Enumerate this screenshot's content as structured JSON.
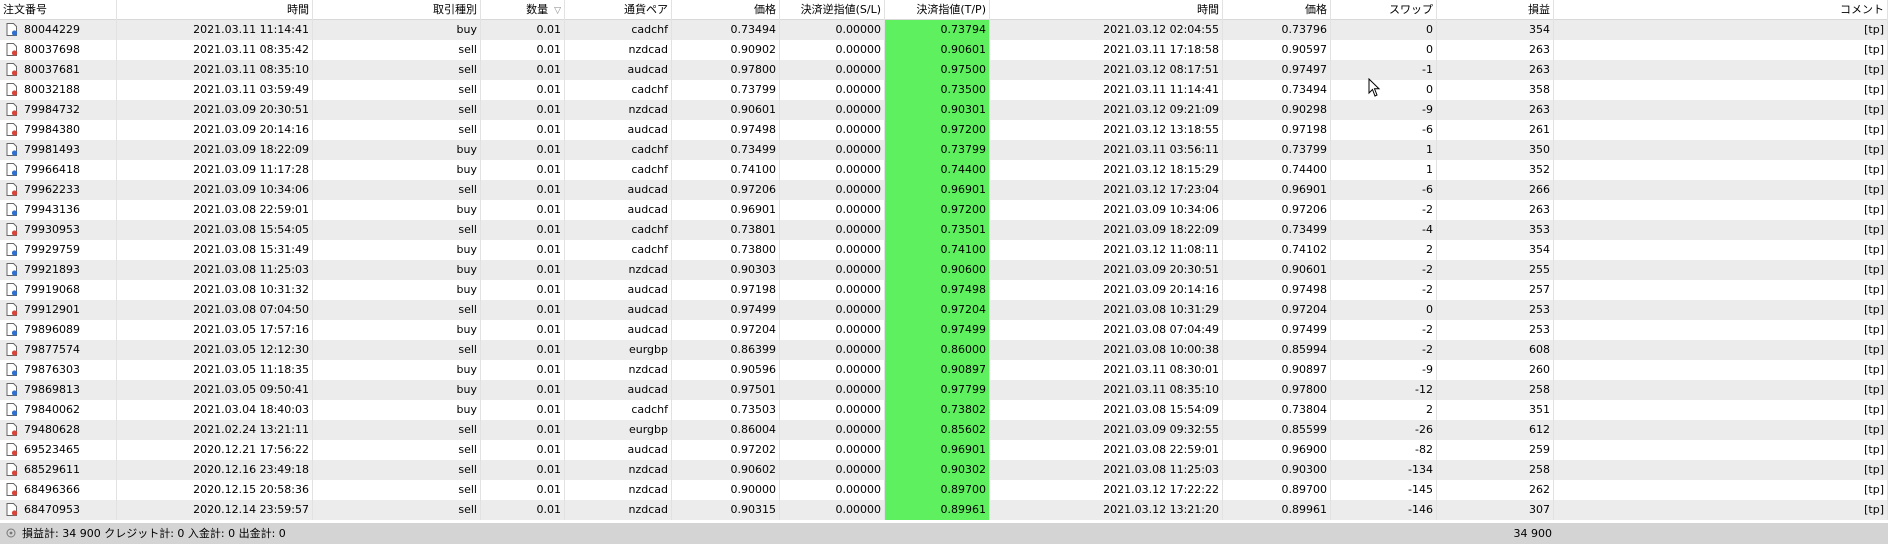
{
  "headers": [
    "注文番号",
    "時間",
    "取引種別",
    "数量",
    "通貨ペア",
    "価格",
    "決済逆指値(S/L)",
    "決済指値(T/P)",
    "時間",
    "価格",
    "スワップ",
    "損益",
    "コメント"
  ],
  "rows": [
    [
      "80044229",
      "2021.03.11 11:14:41",
      "buy",
      "0.01",
      "cadchf",
      "0.73494",
      "0.00000",
      "0.73794",
      "2021.03.12 02:04:55",
      "0.73796",
      "0",
      "354",
      "[tp]"
    ],
    [
      "80037698",
      "2021.03.11 08:35:42",
      "sell",
      "0.01",
      "nzdcad",
      "0.90902",
      "0.00000",
      "0.90601",
      "2021.03.11 17:18:58",
      "0.90597",
      "0",
      "263",
      "[tp]"
    ],
    [
      "80037681",
      "2021.03.11 08:35:10",
      "sell",
      "0.01",
      "audcad",
      "0.97800",
      "0.00000",
      "0.97500",
      "2021.03.12 08:17:51",
      "0.97497",
      "-1",
      "263",
      "[tp]"
    ],
    [
      "80032188",
      "2021.03.11 03:59:49",
      "sell",
      "0.01",
      "cadchf",
      "0.73799",
      "0.00000",
      "0.73500",
      "2021.03.11 11:14:41",
      "0.73494",
      "0",
      "358",
      "[tp]"
    ],
    [
      "79984732",
      "2021.03.09 20:30:51",
      "sell",
      "0.01",
      "nzdcad",
      "0.90601",
      "0.00000",
      "0.90301",
      "2021.03.12 09:21:09",
      "0.90298",
      "-9",
      "263",
      "[tp]"
    ],
    [
      "79984380",
      "2021.03.09 20:14:16",
      "sell",
      "0.01",
      "audcad",
      "0.97498",
      "0.00000",
      "0.97200",
      "2021.03.12 13:18:55",
      "0.97198",
      "-6",
      "261",
      "[tp]"
    ],
    [
      "79981493",
      "2021.03.09 18:22:09",
      "buy",
      "0.01",
      "cadchf",
      "0.73499",
      "0.00000",
      "0.73799",
      "2021.03.11 03:56:11",
      "0.73799",
      "1",
      "350",
      "[tp]"
    ],
    [
      "79966418",
      "2021.03.09 11:17:28",
      "buy",
      "0.01",
      "cadchf",
      "0.74100",
      "0.00000",
      "0.74400",
      "2021.03.12 18:15:29",
      "0.74400",
      "1",
      "352",
      "[tp]"
    ],
    [
      "79962233",
      "2021.03.09 10:34:06",
      "sell",
      "0.01",
      "audcad",
      "0.97206",
      "0.00000",
      "0.96901",
      "2021.03.12 17:23:04",
      "0.96901",
      "-6",
      "266",
      "[tp]"
    ],
    [
      "79943136",
      "2021.03.08 22:59:01",
      "buy",
      "0.01",
      "audcad",
      "0.96901",
      "0.00000",
      "0.97200",
      "2021.03.09 10:34:06",
      "0.97206",
      "-2",
      "263",
      "[tp]"
    ],
    [
      "79930953",
      "2021.03.08 15:54:05",
      "sell",
      "0.01",
      "cadchf",
      "0.73801",
      "0.00000",
      "0.73501",
      "2021.03.09 18:22:09",
      "0.73499",
      "-4",
      "353",
      "[tp]"
    ],
    [
      "79929759",
      "2021.03.08 15:31:49",
      "buy",
      "0.01",
      "cadchf",
      "0.73800",
      "0.00000",
      "0.74100",
      "2021.03.12 11:08:11",
      "0.74102",
      "2",
      "354",
      "[tp]"
    ],
    [
      "79921893",
      "2021.03.08 11:25:03",
      "buy",
      "0.01",
      "nzdcad",
      "0.90303",
      "0.00000",
      "0.90600",
      "2021.03.09 20:30:51",
      "0.90601",
      "-2",
      "255",
      "[tp]"
    ],
    [
      "79919068",
      "2021.03.08 10:31:32",
      "buy",
      "0.01",
      "audcad",
      "0.97198",
      "0.00000",
      "0.97498",
      "2021.03.09 20:14:16",
      "0.97498",
      "-2",
      "257",
      "[tp]"
    ],
    [
      "79912901",
      "2021.03.08 07:04:50",
      "sell",
      "0.01",
      "audcad",
      "0.97499",
      "0.00000",
      "0.97204",
      "2021.03.08 10:31:29",
      "0.97204",
      "0",
      "253",
      "[tp]"
    ],
    [
      "79896089",
      "2021.03.05 17:57:16",
      "buy",
      "0.01",
      "audcad",
      "0.97204",
      "0.00000",
      "0.97499",
      "2021.03.08 07:04:49",
      "0.97499",
      "-2",
      "253",
      "[tp]"
    ],
    [
      "79877574",
      "2021.03.05 12:12:30",
      "sell",
      "0.01",
      "eurgbp",
      "0.86399",
      "0.00000",
      "0.86000",
      "2021.03.08 10:00:38",
      "0.85994",
      "-2",
      "608",
      "[tp]"
    ],
    [
      "79876303",
      "2021.03.05 11:18:35",
      "buy",
      "0.01",
      "nzdcad",
      "0.90596",
      "0.00000",
      "0.90897",
      "2021.03.11 08:30:01",
      "0.90897",
      "-9",
      "260",
      "[tp]"
    ],
    [
      "79869813",
      "2021.03.05 09:50:41",
      "buy",
      "0.01",
      "audcad",
      "0.97501",
      "0.00000",
      "0.97799",
      "2021.03.11 08:35:10",
      "0.97800",
      "-12",
      "258",
      "[tp]"
    ],
    [
      "79840062",
      "2021.03.04 18:40:03",
      "buy",
      "0.01",
      "cadchf",
      "0.73503",
      "0.00000",
      "0.73802",
      "2021.03.08 15:54:09",
      "0.73804",
      "2",
      "351",
      "[tp]"
    ],
    [
      "79480628",
      "2021.02.24 13:21:11",
      "sell",
      "0.01",
      "eurgbp",
      "0.86004",
      "0.00000",
      "0.85602",
      "2021.03.09 09:32:55",
      "0.85599",
      "-26",
      "612",
      "[tp]"
    ],
    [
      "69523465",
      "2020.12.21 17:56:22",
      "sell",
      "0.01",
      "audcad",
      "0.97202",
      "0.00000",
      "0.96901",
      "2021.03.08 22:59:01",
      "0.96900",
      "-82",
      "259",
      "[tp]"
    ],
    [
      "68529611",
      "2020.12.16 23:49:18",
      "sell",
      "0.01",
      "nzdcad",
      "0.90602",
      "0.00000",
      "0.90302",
      "2021.03.08 11:25:03",
      "0.90300",
      "-134",
      "258",
      "[tp]"
    ],
    [
      "68496366",
      "2020.12.15 20:58:36",
      "sell",
      "0.01",
      "nzdcad",
      "0.90000",
      "0.00000",
      "0.89700",
      "2021.03.12 17:22:22",
      "0.89700",
      "-145",
      "262",
      "[tp]"
    ],
    [
      "68470953",
      "2020.12.14 23:59:57",
      "sell",
      "0.01",
      "nzdcad",
      "0.90315",
      "0.00000",
      "0.89961",
      "2021.03.12 13:21:20",
      "0.89961",
      "-146",
      "307",
      "[tp]"
    ]
  ],
  "footer": {
    "summary": "損益計: 34 900  クレジット計: 0  入金計: 0  出金計: 0",
    "total": "34 900"
  },
  "colors": {
    "tp_fill": "#5ef05e",
    "buy_icon": "#2f6fcf",
    "sell_icon": "#d8443a"
  },
  "icons": {
    "order": "order-document-icon",
    "sort": "sort-descending-icon",
    "footer": "summary-circle-icon",
    "cursor": "mouse-pointer-icon"
  }
}
